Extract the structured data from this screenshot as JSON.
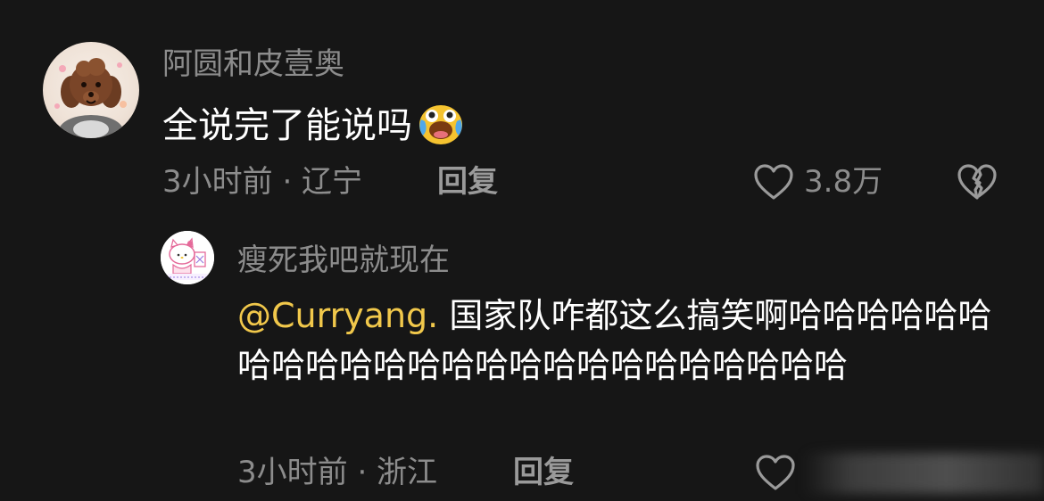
{
  "comment": {
    "username": "阿圆和皮壹奥",
    "text": "全说完了能说吗",
    "emoji": "crying-laughing-face-icon",
    "time": "3小时前 · 辽宁",
    "reply_label": "回复",
    "like_count": "3.8万"
  },
  "reply": {
    "username": "瘦死我吧就现在",
    "mention": "@Curryang.",
    "text": " 国家队咋都这么搞笑啊哈哈哈哈哈哈哈哈哈哈哈哈哈哈哈哈哈哈哈哈哈哈哈哈",
    "time": "3小时前 · 浙江",
    "reply_label": "回复"
  },
  "colors": {
    "background": "#161616",
    "secondary_text": "#8c8c8c",
    "mention": "#f1c84b"
  }
}
